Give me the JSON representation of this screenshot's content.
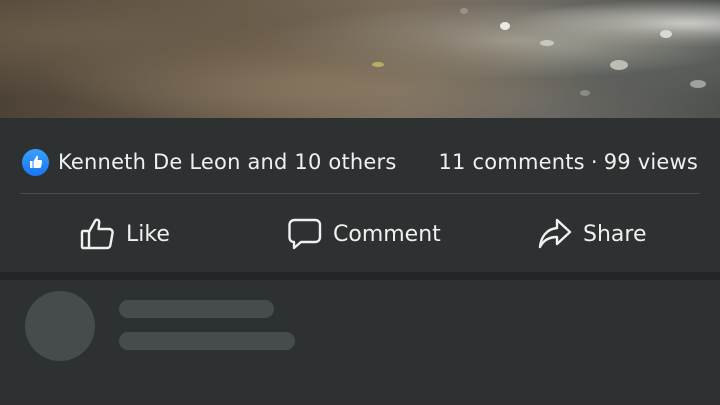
{
  "post": {
    "reactions_text": "Kenneth De Leon and 10 others",
    "comments_text": "11 comments",
    "separator_dot": "·",
    "views_text": "99 views"
  },
  "actions": {
    "like_label": "Like",
    "comment_label": "Comment",
    "share_label": "Share"
  },
  "icons": {
    "reaction": "like-reaction-icon",
    "like": "thumbs-up-icon",
    "comment": "comment-bubble-icon",
    "share": "share-arrow-icon"
  },
  "colors": {
    "background": "#2e3131",
    "like_badge": "#1677f2",
    "text": "#f0f0f0",
    "skeleton": "#464b4d"
  }
}
